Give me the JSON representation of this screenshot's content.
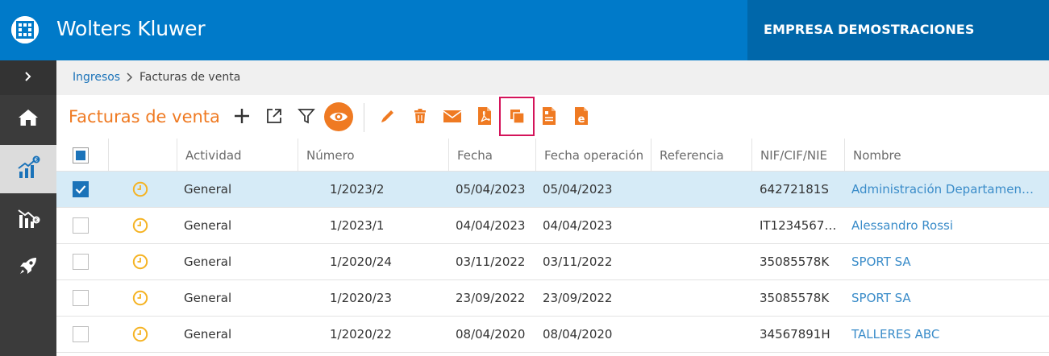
{
  "header": {
    "brand": "Wolters Kluwer",
    "company": "EMPRESA DEMOSTRACIONES"
  },
  "sidebar": {
    "items": [
      {
        "name": "expand",
        "icon": "chevron-right-icon"
      },
      {
        "name": "home",
        "icon": "home-icon"
      },
      {
        "name": "sales",
        "icon": "chart-euro-up-icon",
        "active": true
      },
      {
        "name": "costs",
        "icon": "chart-euro-down-icon"
      },
      {
        "name": "launch",
        "icon": "rocket-icon"
      }
    ]
  },
  "breadcrumb": {
    "parent": "Ingresos",
    "current": "Facturas de venta"
  },
  "page": {
    "title": "Facturas de venta"
  },
  "toolbar": {
    "icons": [
      "plus-icon",
      "open-external-icon",
      "filter-icon",
      "eye-icon",
      "pencil-icon",
      "trash-icon",
      "envelope-icon",
      "pdf-icon",
      "duplicate-icon",
      "document-icon",
      "e-invoice-icon"
    ],
    "highlighted": "duplicate-icon"
  },
  "colors": {
    "header_blue": "#007ac9",
    "company_blue": "#0067aa",
    "accent_orange": "#ef7a22",
    "link_blue": "#3a8cc9",
    "selected_row": "#d6ebf7",
    "highlight_box": "#d4145a",
    "clock_yellow": "#f5b323"
  },
  "table": {
    "columns": [
      "Actividad",
      "Número",
      "Fecha",
      "Fecha operación",
      "Referencia",
      "NIF/CIF/NIE",
      "Nombre"
    ],
    "rows": [
      {
        "checked": true,
        "actividad": "General",
        "numero": "1/2023/2",
        "fecha": "05/04/2023",
        "fecha_operacion": "05/04/2023",
        "referencia": "",
        "nif": "64272181S",
        "nombre": "Administración Departament..."
      },
      {
        "checked": false,
        "actividad": "General",
        "numero": "1/2023/1",
        "fecha": "04/04/2023",
        "fecha_operacion": "04/04/2023",
        "referencia": "",
        "nif": "IT12345670...",
        "nombre": "Alessandro Rossi"
      },
      {
        "checked": false,
        "actividad": "General",
        "numero": "1/2020/24",
        "fecha": "03/11/2022",
        "fecha_operacion": "03/11/2022",
        "referencia": "",
        "nif": "35085578K",
        "nombre": "SPORT SA"
      },
      {
        "checked": false,
        "actividad": "General",
        "numero": "1/2020/23",
        "fecha": "23/09/2022",
        "fecha_operacion": "23/09/2022",
        "referencia": "",
        "nif": "35085578K",
        "nombre": "SPORT SA"
      },
      {
        "checked": false,
        "actividad": "General",
        "numero": "1/2020/22",
        "fecha": "08/04/2020",
        "fecha_operacion": "08/04/2020",
        "referencia": "",
        "nif": "34567891H",
        "nombre": "TALLERES ABC"
      }
    ]
  }
}
